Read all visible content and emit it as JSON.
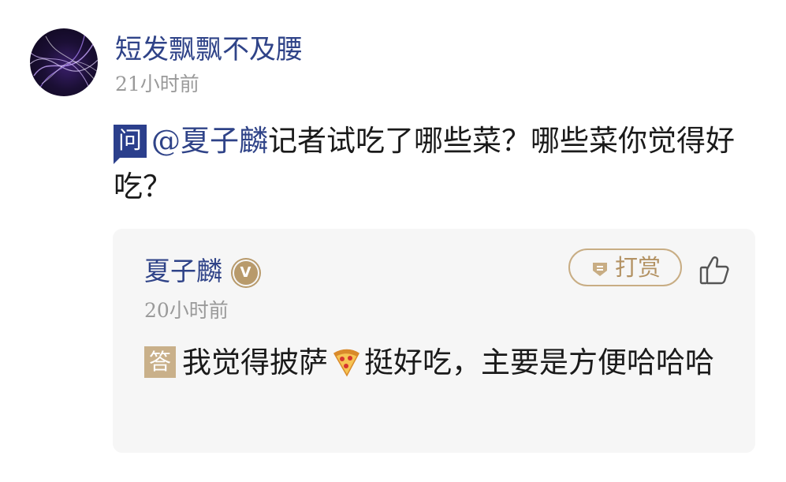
{
  "question": {
    "author": "短发飘飘不及腰",
    "time": "21小时前",
    "badge": "问",
    "mention": "@夏子麟",
    "text": "记者试吃了哪些菜？哪些菜你觉得好吃？"
  },
  "answer": {
    "author": "夏子麟",
    "verified_badge": "V",
    "tip_label": "打赏",
    "time": "20小时前",
    "badge": "答",
    "text_before": "我觉得披萨",
    "text_after": "挺好吃，主要是方便哈哈哈"
  },
  "colors": {
    "link_blue": "#2f4388",
    "question_badge": "#2b3f8c",
    "answer_badge": "#c9b08a",
    "gold": "#b39263",
    "card_bg": "#f6f6f6",
    "meta_gray": "#9a9a9a"
  },
  "icons": {
    "avatar": "avatar-image",
    "verified": "verified-v-icon",
    "tip": "tip-gem-icon",
    "like": "thumbs-up-icon",
    "pizza": "pizza-icon"
  }
}
